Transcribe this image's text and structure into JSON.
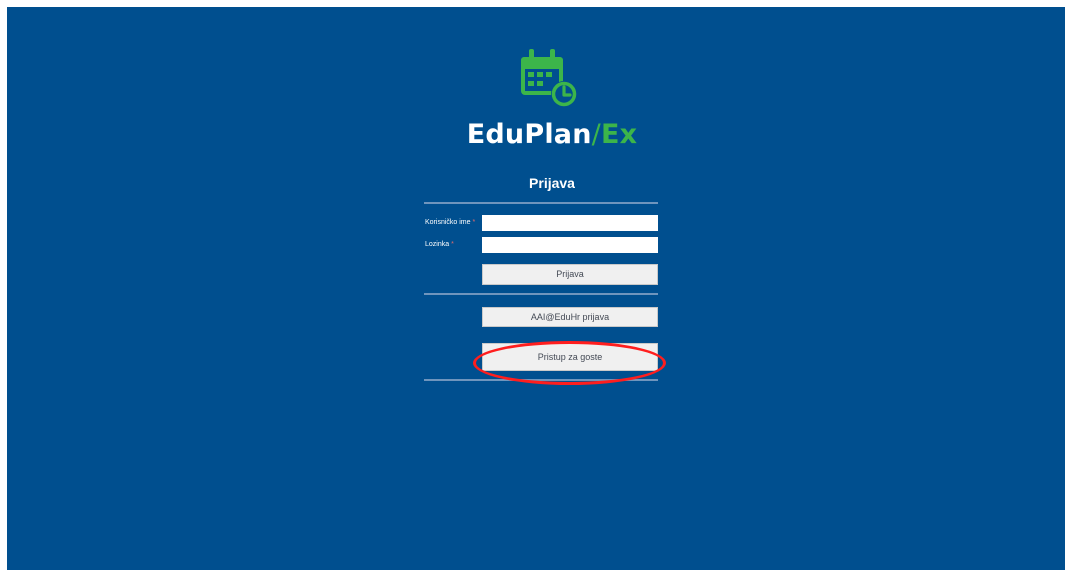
{
  "app": {
    "brand_main": "EduPlan",
    "brand_slash": "/",
    "brand_ex": "Ex",
    "logo_icon": "calendar-clock-icon",
    "accent_color": "#3cb54a",
    "background_color": "#004f8f"
  },
  "login": {
    "title": "Prijava",
    "username_label": "Korisničko ime",
    "password_label": "Lozinka",
    "required_mark": "*",
    "username_value": "",
    "password_value": "",
    "login_button": "Prijava",
    "aai_button": "AAI@EduHr prijava",
    "guest_button": "Pristup za goste"
  },
  "annotation": {
    "highlight_color": "#ff1e1e",
    "highlighted_target": "guest-access-button"
  }
}
